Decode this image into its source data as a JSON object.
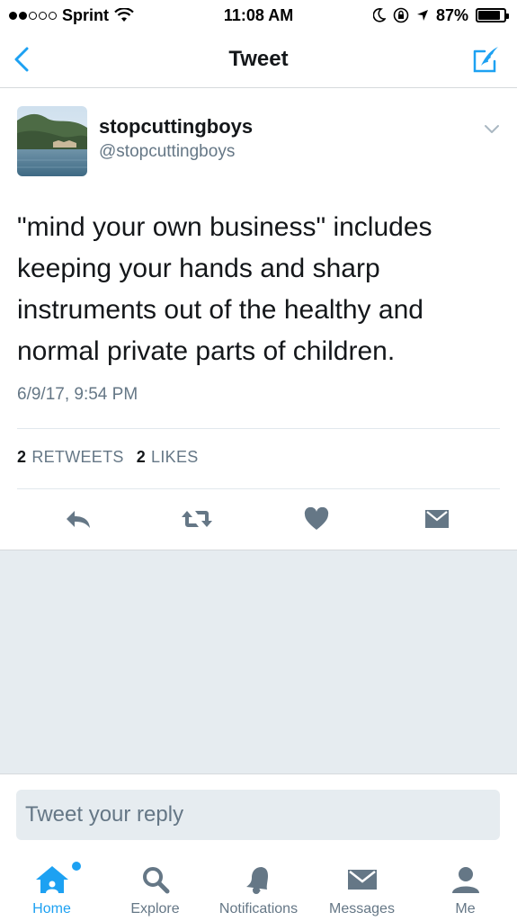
{
  "status_bar": {
    "carrier": "Sprint",
    "time": "11:08 AM",
    "battery_percent": "87%",
    "battery_level": 0.87
  },
  "nav": {
    "title": "Tweet",
    "back_icon": "chevron-left-icon",
    "compose_icon": "compose-tweet-icon"
  },
  "tweet": {
    "user_name": "stopcuttingboys",
    "user_handle": "@stopcuttingboys",
    "text": "\"mind your own business\" includes keeping your hands and sharp instruments out of the healthy and normal private parts of children.",
    "timestamp": "6/9/17, 9:54 PM",
    "retweets_count": "2",
    "retweets_label": "RETWEETS",
    "likes_count": "2",
    "likes_label": "LIKES"
  },
  "reply": {
    "placeholder": "Tweet your reply"
  },
  "tabs": [
    {
      "label": "Home",
      "icon": "home-icon",
      "active": true
    },
    {
      "label": "Explore",
      "icon": "search-icon",
      "active": false
    },
    {
      "label": "Notifications",
      "icon": "bell-icon",
      "active": false
    },
    {
      "label": "Messages",
      "icon": "envelope-icon",
      "active": false
    },
    {
      "label": "Me",
      "icon": "person-icon",
      "active": false
    }
  ],
  "colors": {
    "accent": "#1da1f2",
    "secondary_text": "#657786",
    "background_gray": "#e6ecf0"
  }
}
